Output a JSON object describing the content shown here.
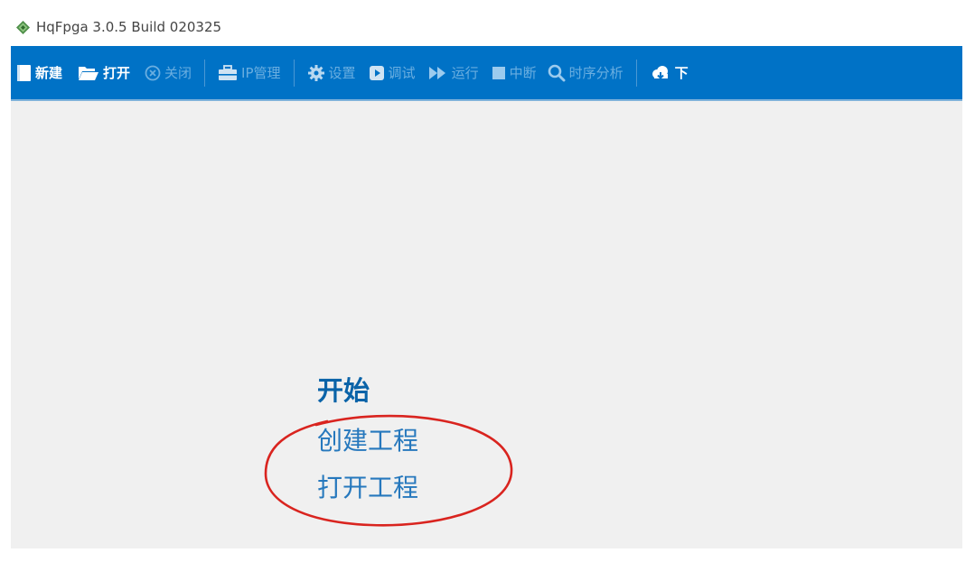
{
  "window": {
    "title": "HqFpga 3.0.5 Build 020325"
  },
  "colors": {
    "toolbar_bg": "#0072c6",
    "toolbar_enabled_text": "#ffffff",
    "toolbar_disabled_text": "#6aaee0",
    "heading": "#0a63a8",
    "link": "#2678bd",
    "annotation": "#d9241f"
  },
  "toolbar": {
    "items": [
      {
        "label": "新建",
        "icon": "new-file-icon",
        "enabled": true
      },
      {
        "label": "打开",
        "icon": "folder-open-icon",
        "enabled": true
      },
      {
        "label": "关闭",
        "icon": "close-circle-icon",
        "enabled": false
      },
      {
        "label": "IP管理",
        "icon": "briefcase-icon",
        "enabled": false
      },
      {
        "label": "设置",
        "icon": "gear-icon",
        "enabled": false
      },
      {
        "label": "调试",
        "icon": "debug-play-icon",
        "enabled": false
      },
      {
        "label": "运行",
        "icon": "fast-forward-icon",
        "enabled": false
      },
      {
        "label": "中断",
        "icon": "stop-icon",
        "enabled": false
      },
      {
        "label": "时序分析",
        "icon": "search-icon",
        "enabled": false
      },
      {
        "label": "下",
        "icon": "cloud-download-icon",
        "enabled": true
      }
    ]
  },
  "start": {
    "heading": "开始",
    "links": [
      "创建工程",
      "打开工程"
    ]
  }
}
